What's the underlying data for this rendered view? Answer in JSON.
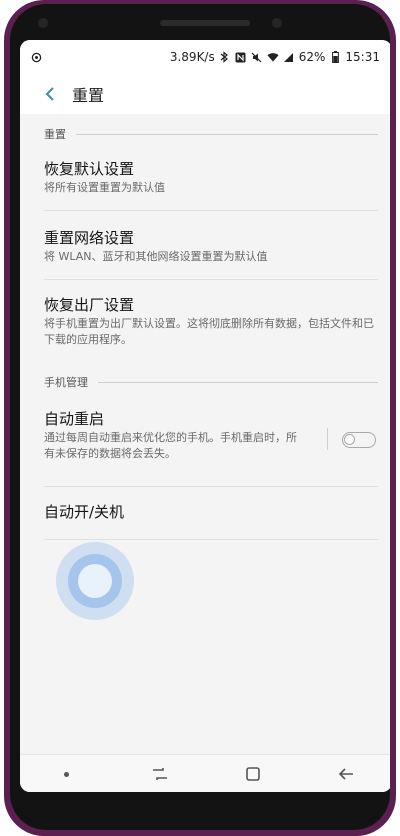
{
  "status_bar": {
    "speed": "3.89K/s",
    "battery": "62%",
    "time": "15:31",
    "icons": [
      "sync-icon",
      "bluetooth-icon",
      "nfc-icon",
      "silent-icon",
      "wifi-icon",
      "signal-icon",
      "battery-icon"
    ]
  },
  "app_bar": {
    "title": "重置"
  },
  "sections": {
    "reset": {
      "header": "重置",
      "items": [
        {
          "title": "恢复默认设置",
          "subtitle": "将所有设置重置为默认值"
        },
        {
          "title": "重置网络设置",
          "subtitle": "将 WLAN、蓝牙和其他网络设置重置为默认值"
        },
        {
          "title": "恢复出厂设置",
          "subtitle": "将手机重置为出厂默认设置。这将彻底删除所有数据，包括文件和已下载的应用程序。"
        }
      ]
    },
    "management": {
      "header": "手机管理",
      "items": [
        {
          "title": "自动重启",
          "subtitle": "通过每周自动重启来优化您的手机。手机重启时，所有未保存的数据将会丢失。",
          "toggle_on": false
        },
        {
          "title": "自动开/关机"
        }
      ]
    }
  },
  "nav_bar": {
    "icons": [
      "dot-icon",
      "recents-icon",
      "home-icon",
      "back-icon"
    ]
  },
  "colors": {
    "accent": "#3f8fa0",
    "background": "#f4f4f4",
    "touch_ripple": "#6aa8ea"
  }
}
